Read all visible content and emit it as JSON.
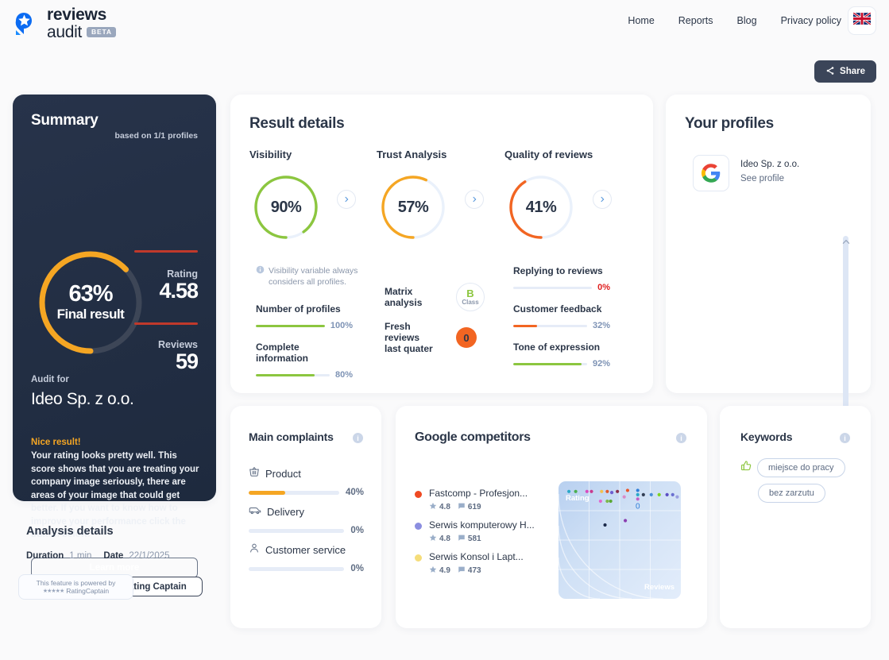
{
  "brand": {
    "logo_line1": "reviews",
    "logo_line2": "audit",
    "badge": "BETA",
    "logo_icon": "reviews-audit-logo"
  },
  "nav": {
    "items": [
      {
        "label": "Home"
      },
      {
        "label": "Reports"
      },
      {
        "label": "Blog"
      },
      {
        "label": "Privacy policy"
      }
    ],
    "language_icon": "uk-flag-icon"
  },
  "share": {
    "label": "Share",
    "icon": "share-icon"
  },
  "summary": {
    "title": "Summary",
    "based_on": "based on 1/1 profiles",
    "final_percent": "63%",
    "final_label": "Final result",
    "final_value": 63,
    "ring_color": "#f5a623",
    "rating_label": "Rating",
    "rating_value": "4.58",
    "reviews_label": "Reviews",
    "reviews_value": "59",
    "audit_for_label": "Audit for",
    "company": "Ideo Sp. z o.o.",
    "verdict_title": "Nice result!",
    "verdict_body": "Your rating looks pretty well. This score shows that you are treating your company image seriously, there are areas of your image that could get better. If you want to know how to improve your performance click the button below.",
    "learn_more": "Learn more"
  },
  "analysis": {
    "title": "Analysis details",
    "duration_label": "Duration",
    "duration_value": "1 min",
    "date_label": "Date",
    "date_value": "22/1/2025",
    "button": "Learn more about Rating Captain"
  },
  "results": {
    "title": "Result details",
    "gauges": [
      {
        "label": "Visibility",
        "value": 90,
        "display": "90%",
        "color": "#8cc63f"
      },
      {
        "label": "Trust Analysis",
        "value": 57,
        "display": "57%",
        "color": "#f5a623"
      },
      {
        "label": "Quality of reviews",
        "value": 41,
        "display": "41%",
        "color": "#f26522"
      }
    ],
    "note": "Visibility variable always considers all profiles.",
    "note_icon": "info-icon",
    "metrics_left": [
      {
        "label": "Number of profiles",
        "value": 100,
        "display": "100%",
        "color": "#8cc63f",
        "pct_color": "#7e93b5"
      },
      {
        "label": "Complete information",
        "value": 80,
        "display": "80%",
        "color": "#8cc63f",
        "pct_color": "#7e93b5"
      }
    ],
    "metrics_right": [
      {
        "label": "Replying to reviews",
        "value": 0,
        "display": "0%",
        "color": "#e74c3c",
        "pct_color": "#e02020"
      },
      {
        "label": "Customer feedback",
        "value": 32,
        "display": "32%",
        "color": "#f26522",
        "pct_color": "#7e93b5"
      },
      {
        "label": "Tone of expression",
        "value": 92,
        "display": "92%",
        "color": "#8cc63f",
        "pct_color": "#7e93b5"
      }
    ],
    "matrix": {
      "label": "Matrix analysis",
      "class_letter": "B",
      "class_word": "Class"
    },
    "fresh": {
      "label_line1": "Fresh reviews",
      "label_line2": "last quater",
      "value": "0",
      "color": "#f26522"
    }
  },
  "profiles": {
    "title": "Your profiles",
    "items": [
      {
        "name": "Ideo Sp. z o.o.",
        "link": "See profile",
        "icon": "google-icon"
      }
    ],
    "scroll_icon": "chevron-up-icon"
  },
  "complaints": {
    "title": "Main complaints",
    "info_icon": "info-icon",
    "items": [
      {
        "label": "Product",
        "icon": "basket-icon",
        "value": 40,
        "display": "40%"
      },
      {
        "label": "Delivery",
        "icon": "van-icon",
        "value": 0,
        "display": "0%"
      },
      {
        "label": "Customer service",
        "icon": "person-icon",
        "value": 0,
        "display": "0%"
      }
    ],
    "powered_line1": "This feature is powered by",
    "powered_line2": "RatingCaptain",
    "powered_stars": "★★★★★"
  },
  "competitors": {
    "title": "Google competitors",
    "info_icon": "info-icon",
    "items": [
      {
        "name": "Fastcomp - Profesjon...",
        "rating": "4.8",
        "reviews": "619",
        "color": "#ef4a23"
      },
      {
        "name": "Serwis komputerowy H...",
        "rating": "4.8",
        "reviews": "581",
        "color": "#8b8ee0"
      },
      {
        "name": "Serwis Konsol i Lapt...",
        "rating": "4.9",
        "reviews": "473",
        "color": "#f5dd7a"
      }
    ],
    "star_icon": "star-icon",
    "comment_icon": "comment-icon"
  },
  "chart_data": {
    "type": "scatter",
    "title": "Google competitors matrix",
    "xlabel": "Reviews",
    "ylabel": "Rating",
    "xlim": [
      0,
      100
    ],
    "ylim": [
      0,
      100
    ],
    "grid": true,
    "axis_label_topleft": "Rating",
    "axis_label_bottomright": "Reviews",
    "points": [
      {
        "x": 5,
        "y": 95,
        "color": "#2aa8c9"
      },
      {
        "x": 11,
        "y": 95,
        "color": "#4caf50"
      },
      {
        "x": 21,
        "y": 95,
        "color": "#d94cc0"
      },
      {
        "x": 25,
        "y": 95,
        "color": "#c93a8e"
      },
      {
        "x": 34,
        "y": 95,
        "color": "#f2c14e"
      },
      {
        "x": 39,
        "y": 95,
        "color": "#e05a2b"
      },
      {
        "x": 43,
        "y": 94,
        "color": "#6f5fd0"
      },
      {
        "x": 48,
        "y": 95,
        "color": "#8b2f4d"
      },
      {
        "x": 57,
        "y": 96,
        "color": "#e8572b"
      },
      {
        "x": 54,
        "y": 90,
        "color": "#d98cc8"
      },
      {
        "x": 33,
        "y": 86,
        "color": "#e06ad0"
      },
      {
        "x": 39,
        "y": 86,
        "color": "#7db84a"
      },
      {
        "x": 42,
        "y": 86,
        "color": "#5aa832"
      },
      {
        "x": 66,
        "y": 96,
        "color": "#2f7ed8"
      },
      {
        "x": 66,
        "y": 92,
        "color": "#2aa8c9"
      },
      {
        "x": 71,
        "y": 92,
        "color": "#333f55"
      },
      {
        "x": 78,
        "y": 92,
        "color": "#4a90d9"
      },
      {
        "x": 85,
        "y": 92,
        "color": "#7ed321"
      },
      {
        "x": 66,
        "y": 88,
        "color": "#c060c8"
      },
      {
        "x": 92,
        "y": 92,
        "color": "#5b4fc4"
      },
      {
        "x": 97,
        "y": 92,
        "color": "#6a6fd0"
      },
      {
        "x": 101,
        "y": 90,
        "color": "#9a9fe0"
      },
      {
        "x": 37,
        "y": 64,
        "color": "#1b2a4a"
      },
      {
        "x": 55,
        "y": 68,
        "color": "#8b3fb0"
      },
      {
        "x": 66,
        "y": 82,
        "color": "#2f7ed8",
        "label": "0"
      }
    ]
  },
  "keywords": {
    "title": "Keywords",
    "info_icon": "info-icon",
    "thumb_icon": "thumbs-up-icon",
    "items": [
      {
        "label": "miejsce do pracy",
        "sentiment": "positive"
      },
      {
        "label": "bez zarzutu",
        "sentiment": "neutral"
      }
    ]
  }
}
